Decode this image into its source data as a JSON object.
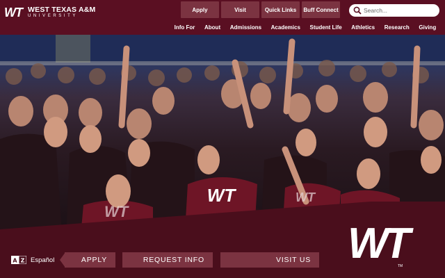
{
  "header": {
    "logo_mark": "WT",
    "logo_name": "WEST TEXAS A&M",
    "logo_sub": "UNIVERSITY",
    "top_buttons": [
      "Apply",
      "Visit",
      "Quick Links",
      "Buff Connect"
    ],
    "search_placeholder": "Search...",
    "nav": [
      "Info For",
      "About",
      "Admissions",
      "Academics",
      "Student Life",
      "Athletics",
      "Research",
      "Giving"
    ]
  },
  "hero": {
    "shirt_text": "WT"
  },
  "footer": {
    "language_label": "Español",
    "cta_buttons": [
      "APPLY",
      "REQUEST INFO",
      "VISIT US"
    ],
    "big_logo": "WT",
    "trademark": "TM"
  },
  "colors": {
    "maroon": "#5a0f22",
    "button": "#7b3341",
    "dark": "#4a0e1c"
  }
}
